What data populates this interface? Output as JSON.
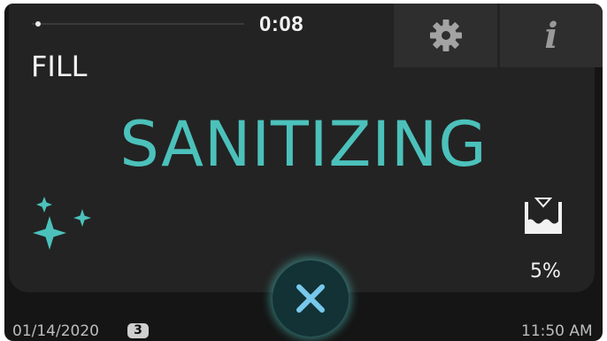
{
  "cycle": {
    "phase": "FILL",
    "elapsed_time": "0:08",
    "progress_fraction": 0.03,
    "status": "SANITIZING"
  },
  "toolbar": {
    "settings_icon": "gear-icon",
    "info_label": "i"
  },
  "water_level": {
    "icon": "water-level-icon",
    "percent_text": "5%"
  },
  "cancel": {
    "icon": "close-icon"
  },
  "footer": {
    "date": "01/14/2020",
    "badge_count": "3",
    "time": "11:50 AM"
  },
  "colors": {
    "accent": "#4cc1bb",
    "background": "#151515",
    "panel": "#232323",
    "text": "#f2f2f2"
  }
}
